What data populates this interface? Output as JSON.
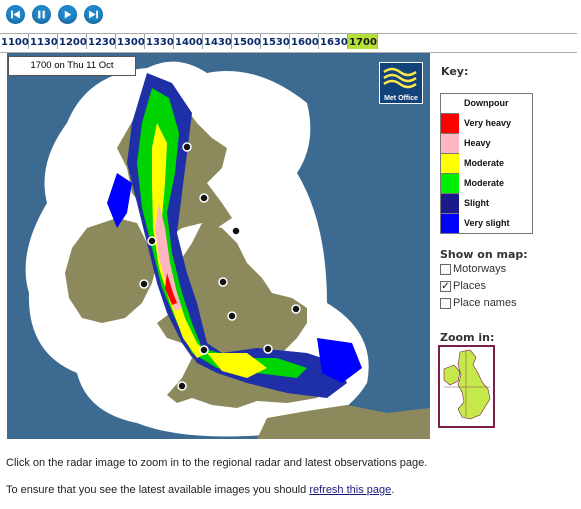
{
  "controls": [
    {
      "name": "skip-back-button",
      "icon": "skip-back-icon"
    },
    {
      "name": "pause-button",
      "icon": "pause-icon"
    },
    {
      "name": "play-button",
      "icon": "play-icon"
    },
    {
      "name": "skip-forward-button",
      "icon": "skip-forward-icon"
    }
  ],
  "timeline": {
    "slots": [
      "1100",
      "1130",
      "1200",
      "1230",
      "1300",
      "1330",
      "1400",
      "1430",
      "1500",
      "1530",
      "1600",
      "1630",
      "1700"
    ],
    "active": "1700",
    "active_color": "#b5e03a"
  },
  "map": {
    "timestamp": "1700 on Thu 11 Oct",
    "logo_label": "Met Office",
    "sea_color": "#3d6a91",
    "land_color": "#8c8a5c"
  },
  "key": {
    "title": "Key:",
    "items": [
      {
        "label": "Downpour",
        "color": "#ffffff"
      },
      {
        "label": "Very heavy",
        "color": "#ff0000"
      },
      {
        "label": "Heavy",
        "color": "#ffb6c1"
      },
      {
        "label": "Moderate",
        "color": "#ffff00"
      },
      {
        "label": "Moderate",
        "color": "#00ee00"
      },
      {
        "label": "Slight",
        "color": "#1a1a8a"
      },
      {
        "label": "Very slight",
        "color": "#0000ff"
      }
    ]
  },
  "show_on_map": {
    "title": "Show on map:",
    "options": [
      {
        "label": "Motorways",
        "checked": false
      },
      {
        "label": "Places",
        "checked": true
      },
      {
        "label": "Place names",
        "checked": false
      }
    ]
  },
  "zoom": {
    "title": "Zoom in:"
  },
  "footer": {
    "line1": "Click on the radar image to zoom in to the regional radar and latest observations page.",
    "line2_pre": "To ensure that you see the latest available images you should ",
    "line2_link": "refresh this page",
    "line2_post": "."
  }
}
